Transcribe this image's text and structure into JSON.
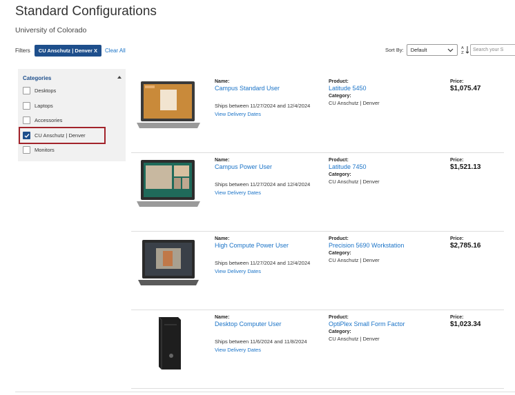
{
  "page": {
    "title": "Standard Configurations",
    "subtitle": "University of Colorado"
  },
  "filters": {
    "label": "Filters",
    "chip": "CU Anschutz | Denver X",
    "clear_all": "Clear All"
  },
  "sort": {
    "label": "Sort By:",
    "selected": "Default",
    "search_placeholder": "Search your S"
  },
  "sidebar": {
    "header": "Categories",
    "items": [
      {
        "label": "Desktops",
        "checked": false
      },
      {
        "label": "Laptops",
        "checked": false
      },
      {
        "label": "Accessories",
        "checked": false
      },
      {
        "label": "CU Anschutz | Denver",
        "checked": true
      },
      {
        "label": "Monitors",
        "checked": false
      }
    ]
  },
  "labels": {
    "name": "Name:",
    "product": "Product:",
    "category": "Category:",
    "price": "Price:",
    "delivery": "View Delivery Dates"
  },
  "products": [
    {
      "name": "Campus Standard User",
      "ships": "Ships between 11/27/2024 and 12/4/2024",
      "product": "Latitude 5450",
      "category": "CU Anschutz | Denver",
      "price": "$1,075.47"
    },
    {
      "name": "Campus Power User",
      "ships": "Ships between 11/27/2024 and 12/4/2024",
      "product": "Latitude 7450",
      "category": "CU Anschutz | Denver",
      "price": "$1,521.13"
    },
    {
      "name": "High Compute Power User",
      "ships": "Ships between 11/27/2024 and 12/4/2024",
      "product": "Precision 5690 Workstation",
      "category": "CU Anschutz | Denver",
      "price": "$2,785.16"
    },
    {
      "name": "Desktop Computer User",
      "ships": "Ships between 11/6/2024 and 11/8/2024",
      "product": "OptiPlex Small Form Factor",
      "category": "CU Anschutz | Denver",
      "price": "$1,023.34"
    }
  ],
  "colors": {
    "accent": "#1e4f8c",
    "link": "#1a73c7",
    "highlight": "#a2222a"
  }
}
